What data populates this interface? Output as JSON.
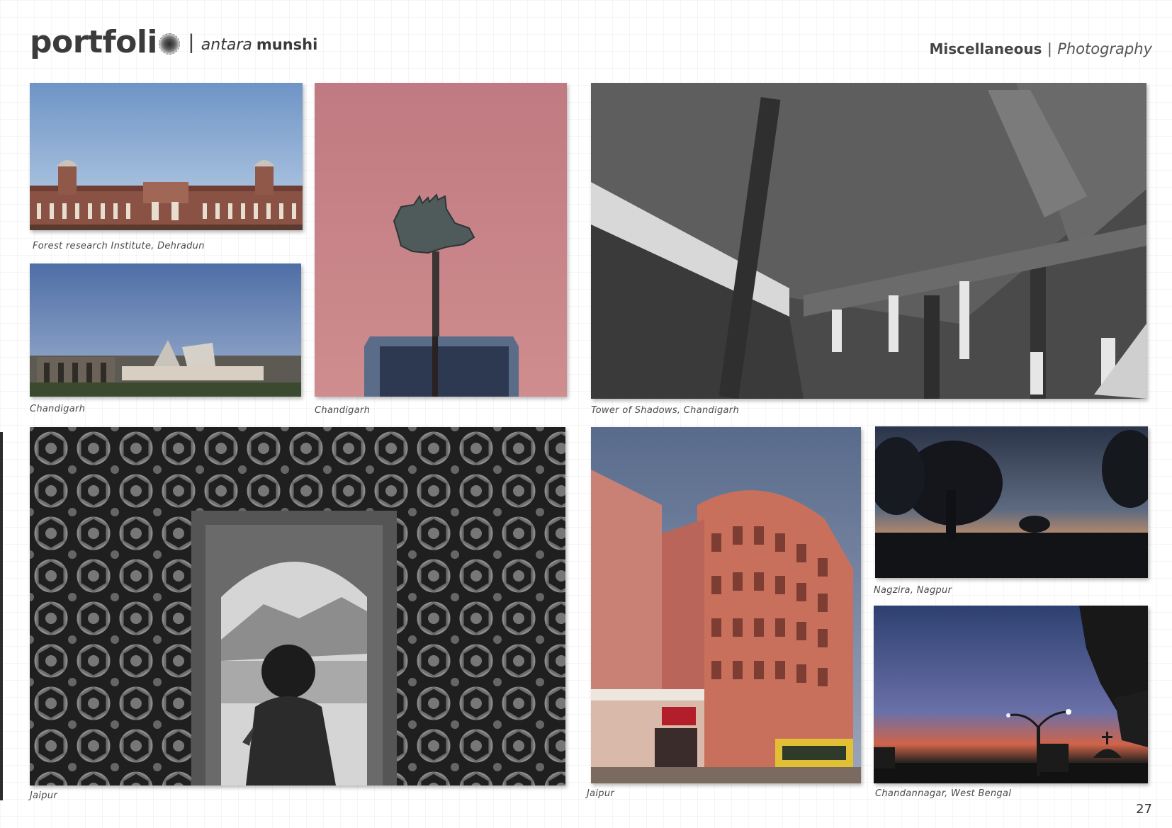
{
  "header": {
    "brand": "portfoli",
    "separator": "|",
    "author_first": "antara",
    "author_last": "munshi",
    "section": "Miscellaneous",
    "section_separator": "|",
    "subsection": "Photography"
  },
  "photos": [
    {
      "caption": "Forest research Institute, Dehradun"
    },
    {
      "caption": "Chandigarh"
    },
    {
      "caption": "Chandigarh"
    },
    {
      "caption": "Tower of Shadows, Chandigarh"
    },
    {
      "caption": "Jaipur"
    },
    {
      "caption": "Jaipur"
    },
    {
      "caption": "Nagzira, Nagpur"
    },
    {
      "caption": "Chandannagar, West Bengal"
    }
  ],
  "page_number": "27",
  "colors": {
    "text": "#3a3a3a",
    "sky_blue": "#7f9ec8",
    "dusk_pink": "#c98184",
    "sandstone": "#c9705d"
  }
}
